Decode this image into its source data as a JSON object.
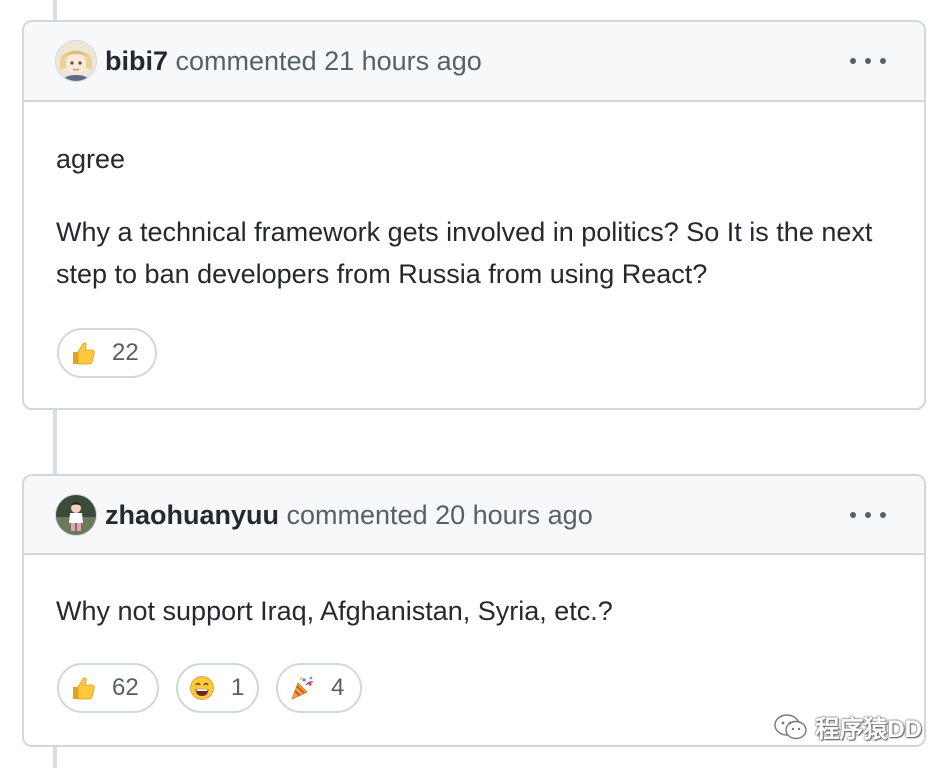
{
  "comments": [
    {
      "author": "bibi7",
      "meta": "commented 21 hours ago",
      "paragraphs": [
        "agree",
        "Why a technical framework gets involved in politics? So It is the next step to ban developers from Russia from using React?"
      ],
      "reactions": [
        {
          "icon": "thumbs-up-icon",
          "count": "22"
        }
      ]
    },
    {
      "author": "zhaohuanyuu",
      "meta": "commented 20 hours ago",
      "paragraphs": [
        "Why not support Iraq, Afghanistan, Syria, etc.?"
      ],
      "reactions": [
        {
          "icon": "thumbs-up-icon",
          "count": "62"
        },
        {
          "icon": "laugh-icon",
          "count": "1"
        },
        {
          "icon": "tada-icon",
          "count": "4"
        }
      ]
    }
  ],
  "watermark": "程序猿DD",
  "colors": {
    "border": "#d0d7de",
    "header_bg": "#f6f8fa",
    "text": "#24292f",
    "muted": "#57606a"
  }
}
